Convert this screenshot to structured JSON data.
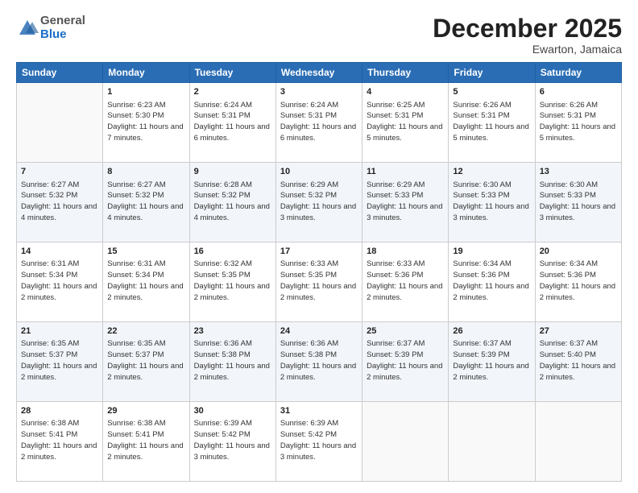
{
  "logo": {
    "general": "General",
    "blue": "Blue"
  },
  "title": "December 2025",
  "location": "Ewarton, Jamaica",
  "weekdays": [
    "Sunday",
    "Monday",
    "Tuesday",
    "Wednesday",
    "Thursday",
    "Friday",
    "Saturday"
  ],
  "weeks": [
    [
      {
        "day": "",
        "empty": true
      },
      {
        "day": "1",
        "sunrise": "6:23 AM",
        "sunset": "5:30 PM",
        "daylight": "11 hours and 7 minutes."
      },
      {
        "day": "2",
        "sunrise": "6:24 AM",
        "sunset": "5:31 PM",
        "daylight": "11 hours and 6 minutes."
      },
      {
        "day": "3",
        "sunrise": "6:24 AM",
        "sunset": "5:31 PM",
        "daylight": "11 hours and 6 minutes."
      },
      {
        "day": "4",
        "sunrise": "6:25 AM",
        "sunset": "5:31 PM",
        "daylight": "11 hours and 5 minutes."
      },
      {
        "day": "5",
        "sunrise": "6:26 AM",
        "sunset": "5:31 PM",
        "daylight": "11 hours and 5 minutes."
      },
      {
        "day": "6",
        "sunrise": "6:26 AM",
        "sunset": "5:31 PM",
        "daylight": "11 hours and 5 minutes."
      }
    ],
    [
      {
        "day": "7",
        "sunrise": "6:27 AM",
        "sunset": "5:32 PM",
        "daylight": "11 hours and 4 minutes."
      },
      {
        "day": "8",
        "sunrise": "6:27 AM",
        "sunset": "5:32 PM",
        "daylight": "11 hours and 4 minutes."
      },
      {
        "day": "9",
        "sunrise": "6:28 AM",
        "sunset": "5:32 PM",
        "daylight": "11 hours and 4 minutes."
      },
      {
        "day": "10",
        "sunrise": "6:29 AM",
        "sunset": "5:32 PM",
        "daylight": "11 hours and 3 minutes."
      },
      {
        "day": "11",
        "sunrise": "6:29 AM",
        "sunset": "5:33 PM",
        "daylight": "11 hours and 3 minutes."
      },
      {
        "day": "12",
        "sunrise": "6:30 AM",
        "sunset": "5:33 PM",
        "daylight": "11 hours and 3 minutes."
      },
      {
        "day": "13",
        "sunrise": "6:30 AM",
        "sunset": "5:33 PM",
        "daylight": "11 hours and 3 minutes."
      }
    ],
    [
      {
        "day": "14",
        "sunrise": "6:31 AM",
        "sunset": "5:34 PM",
        "daylight": "11 hours and 2 minutes."
      },
      {
        "day": "15",
        "sunrise": "6:31 AM",
        "sunset": "5:34 PM",
        "daylight": "11 hours and 2 minutes."
      },
      {
        "day": "16",
        "sunrise": "6:32 AM",
        "sunset": "5:35 PM",
        "daylight": "11 hours and 2 minutes."
      },
      {
        "day": "17",
        "sunrise": "6:33 AM",
        "sunset": "5:35 PM",
        "daylight": "11 hours and 2 minutes."
      },
      {
        "day": "18",
        "sunrise": "6:33 AM",
        "sunset": "5:36 PM",
        "daylight": "11 hours and 2 minutes."
      },
      {
        "day": "19",
        "sunrise": "6:34 AM",
        "sunset": "5:36 PM",
        "daylight": "11 hours and 2 minutes."
      },
      {
        "day": "20",
        "sunrise": "6:34 AM",
        "sunset": "5:36 PM",
        "daylight": "11 hours and 2 minutes."
      }
    ],
    [
      {
        "day": "21",
        "sunrise": "6:35 AM",
        "sunset": "5:37 PM",
        "daylight": "11 hours and 2 minutes."
      },
      {
        "day": "22",
        "sunrise": "6:35 AM",
        "sunset": "5:37 PM",
        "daylight": "11 hours and 2 minutes."
      },
      {
        "day": "23",
        "sunrise": "6:36 AM",
        "sunset": "5:38 PM",
        "daylight": "11 hours and 2 minutes."
      },
      {
        "day": "24",
        "sunrise": "6:36 AM",
        "sunset": "5:38 PM",
        "daylight": "11 hours and 2 minutes."
      },
      {
        "day": "25",
        "sunrise": "6:37 AM",
        "sunset": "5:39 PM",
        "daylight": "11 hours and 2 minutes."
      },
      {
        "day": "26",
        "sunrise": "6:37 AM",
        "sunset": "5:39 PM",
        "daylight": "11 hours and 2 minutes."
      },
      {
        "day": "27",
        "sunrise": "6:37 AM",
        "sunset": "5:40 PM",
        "daylight": "11 hours and 2 minutes."
      }
    ],
    [
      {
        "day": "28",
        "sunrise": "6:38 AM",
        "sunset": "5:41 PM",
        "daylight": "11 hours and 2 minutes."
      },
      {
        "day": "29",
        "sunrise": "6:38 AM",
        "sunset": "5:41 PM",
        "daylight": "11 hours and 2 minutes."
      },
      {
        "day": "30",
        "sunrise": "6:39 AM",
        "sunset": "5:42 PM",
        "daylight": "11 hours and 3 minutes."
      },
      {
        "day": "31",
        "sunrise": "6:39 AM",
        "sunset": "5:42 PM",
        "daylight": "11 hours and 3 minutes."
      },
      {
        "day": "",
        "empty": true
      },
      {
        "day": "",
        "empty": true
      },
      {
        "day": "",
        "empty": true
      }
    ]
  ]
}
